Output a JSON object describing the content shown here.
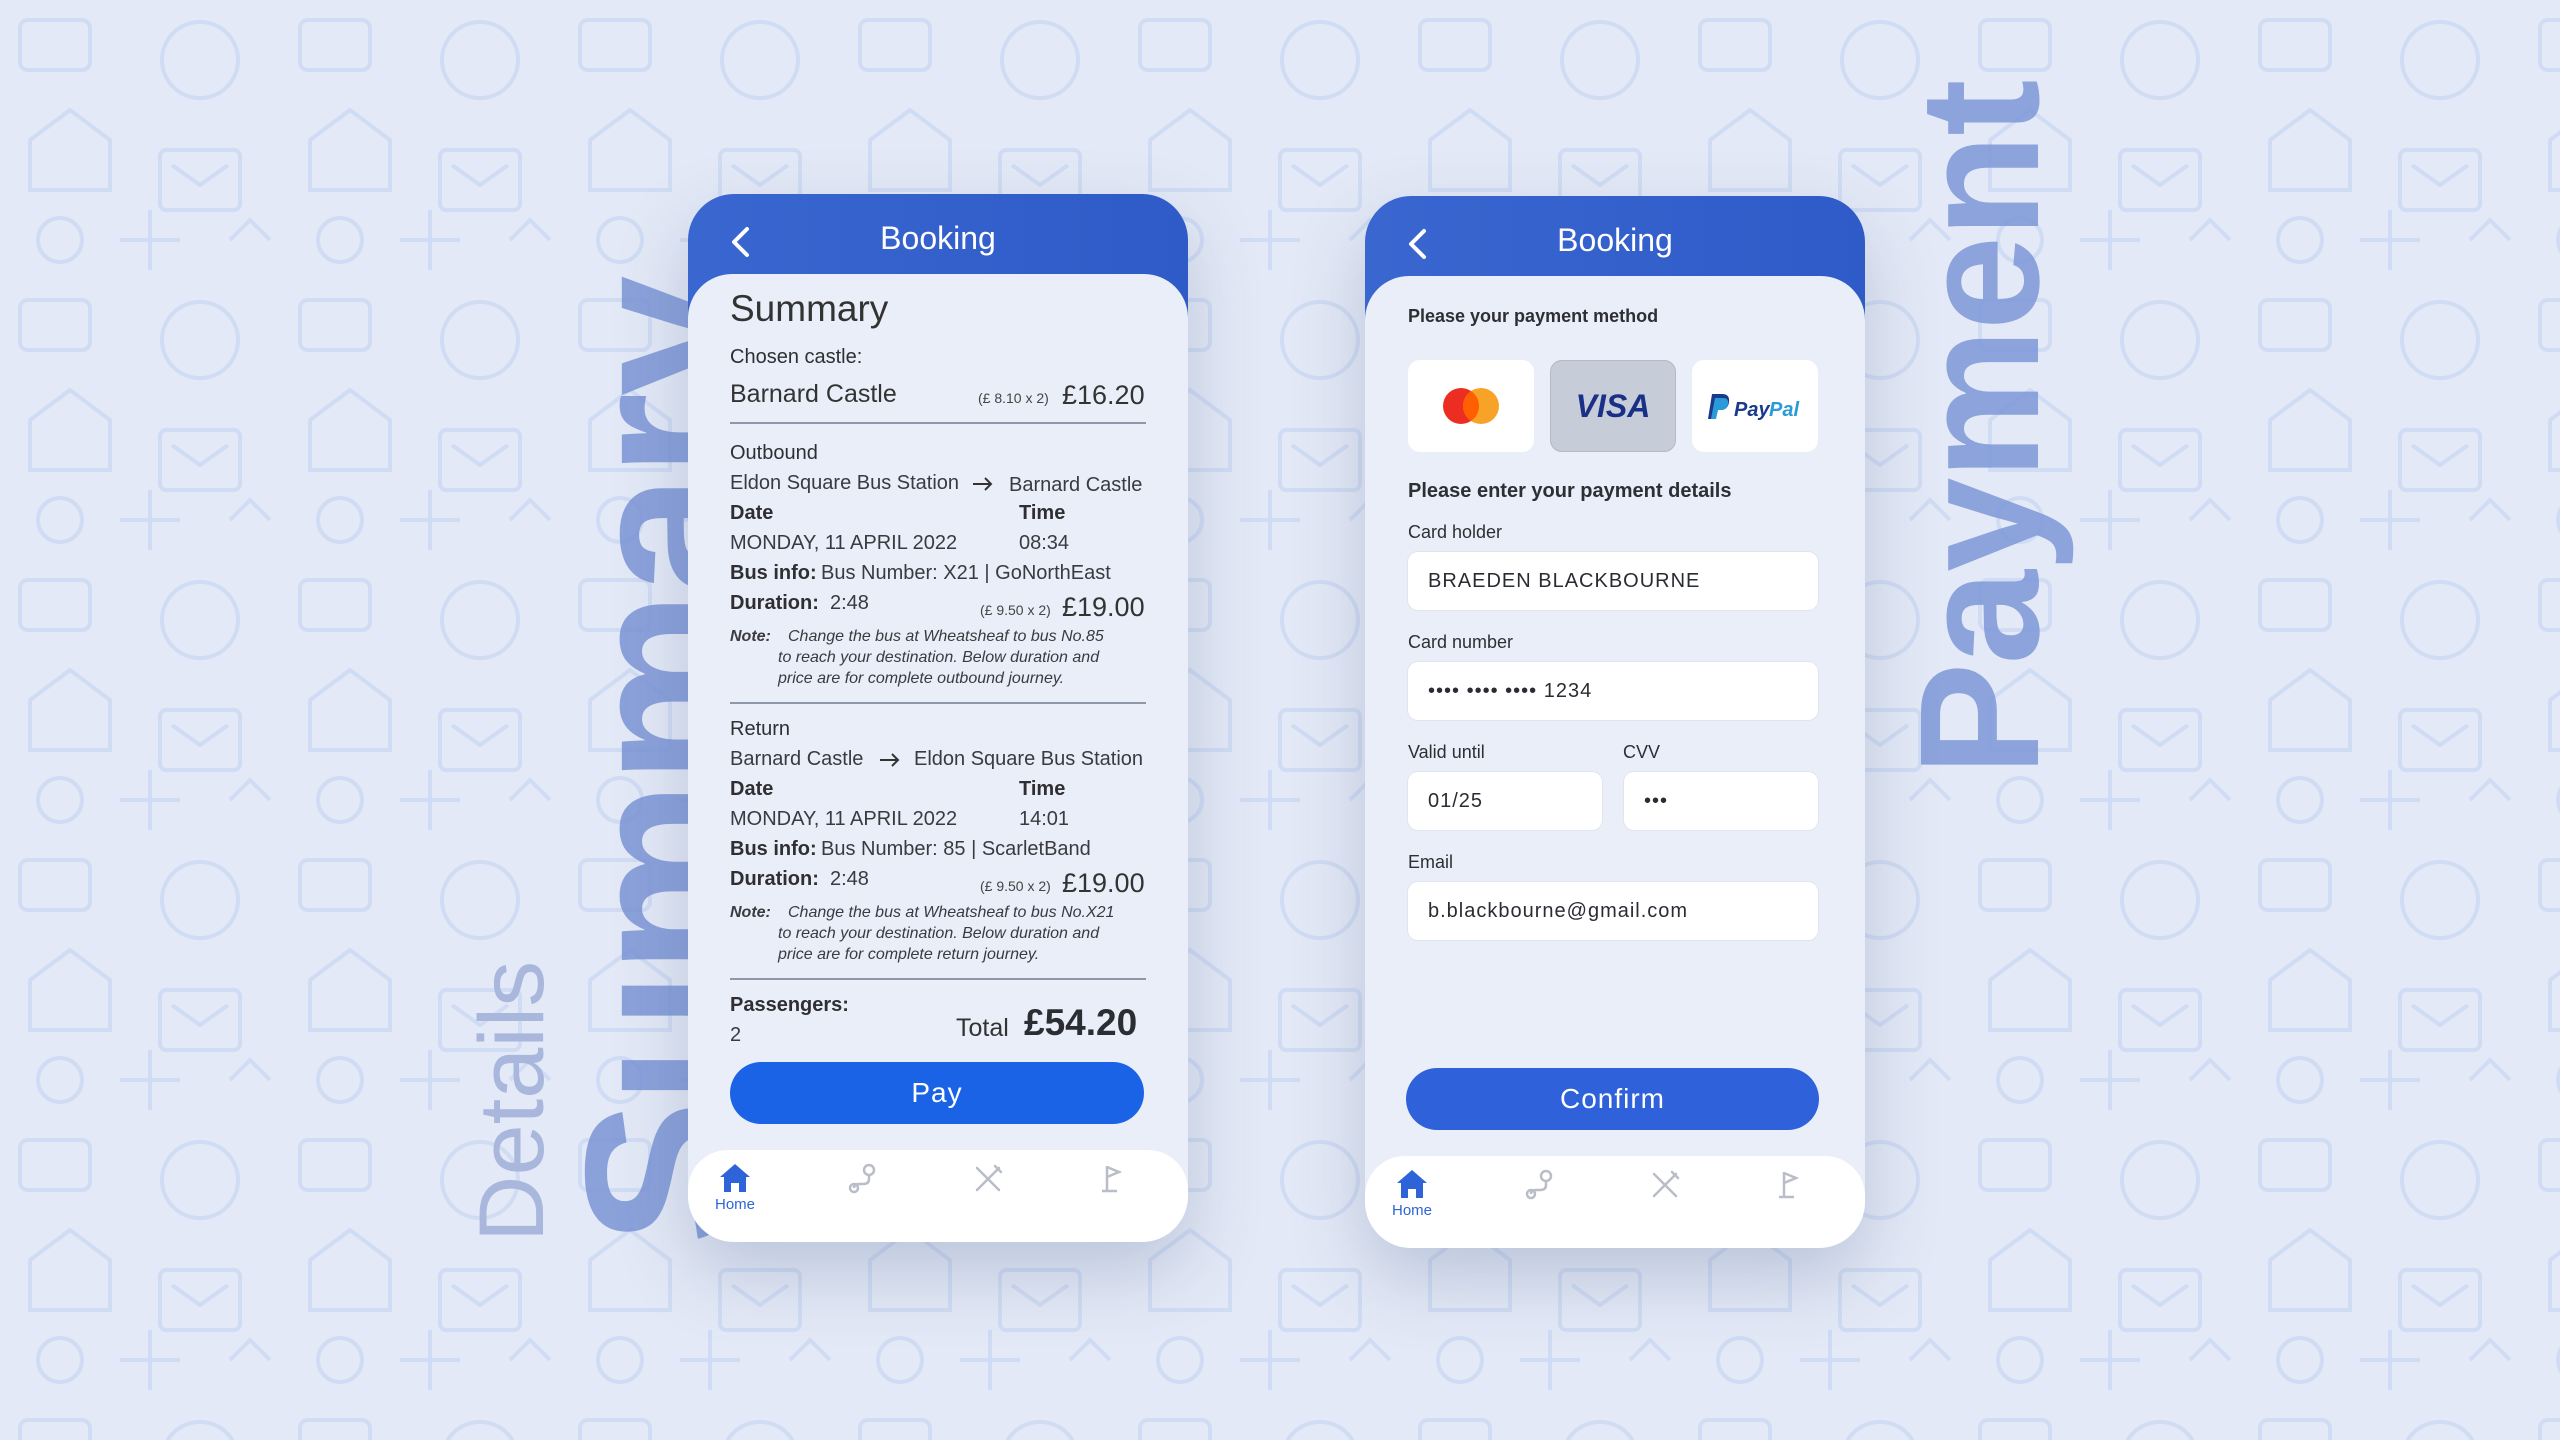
{
  "colors": {
    "background": "#e3e9f6",
    "primary": "#2f5bc9",
    "pay_button": "#1b63e6",
    "accent_text": "#2e64d8"
  },
  "decor": {
    "details_word": "Details",
    "summary_word": "Summary",
    "payment_word": "Payment"
  },
  "summary_screen": {
    "header_title": "Booking",
    "heading": "Summary",
    "chosen_castle_label": "Chosen castle:",
    "castle_name": "Barnard Castle",
    "castle_calc": "(£ 8.10 x 2)",
    "castle_price": "£16.20",
    "outbound": {
      "label": "Outbound",
      "from": "Eldon Square Bus Station",
      "to": "Barnard Castle",
      "date_label": "Date",
      "date": "MONDAY, 11 APRIL 2022",
      "time_label": "Time",
      "time": "08:34",
      "businfo_label": "Bus info:",
      "businfo": "Bus Number: X21 | GoNorthEast",
      "duration_label": "Duration:",
      "duration": "2:48",
      "calc": "(£ 9.50 x 2)",
      "price": "£19.00",
      "note_label": "Note:",
      "note_lines": [
        "Change the bus at Wheatsheaf to bus No.85",
        "to reach your destination. Below duration and",
        "price are for complete outbound journey."
      ]
    },
    "return": {
      "label": "Return",
      "from": "Barnard Castle",
      "to": "Eldon Square Bus Station",
      "date_label": "Date",
      "date": "MONDAY, 11 APRIL 2022",
      "time_label": "Time",
      "time": "14:01",
      "businfo_label": "Bus info:",
      "businfo": "Bus Number: 85 | ScarletBand",
      "duration_label": "Duration:",
      "duration": "2:48",
      "calc": "(£ 9.50 x 2)",
      "price": "£19.00",
      "note_label": "Note:",
      "note_lines": [
        "Change the bus at Wheatsheaf to bus No.X21",
        "to reach your destination. Below duration and",
        "price are for complete return journey."
      ]
    },
    "passengers_label": "Passengers:",
    "passengers": "2",
    "total_label": "Total",
    "total": "£54.20",
    "pay_label": "Pay",
    "nav": {
      "home_label": "Home"
    }
  },
  "payment_screen": {
    "header_title": "Booking",
    "method_prompt": "Please your payment method",
    "methods": [
      {
        "name": "Mastercard",
        "icon": "mastercard-icon",
        "selected": false
      },
      {
        "name": "VISA",
        "icon": "visa-icon",
        "selected": true
      },
      {
        "name": "PayPal",
        "icon": "paypal-icon",
        "selected": false
      }
    ],
    "details_prompt": "Please enter your payment details",
    "card_holder_label": "Card holder",
    "card_holder": "BRAEDEN BLACKBOURNE",
    "card_number_label": "Card number",
    "card_number": "•••• •••• •••• 1234",
    "valid_label": "Valid until",
    "valid": "01/25",
    "cvv_label": "CVV",
    "cvv": "•••",
    "email_label": "Email",
    "email": "b.blackbourne@gmail.com",
    "confirm_label": "Confirm",
    "nav": {
      "home_label": "Home"
    }
  }
}
